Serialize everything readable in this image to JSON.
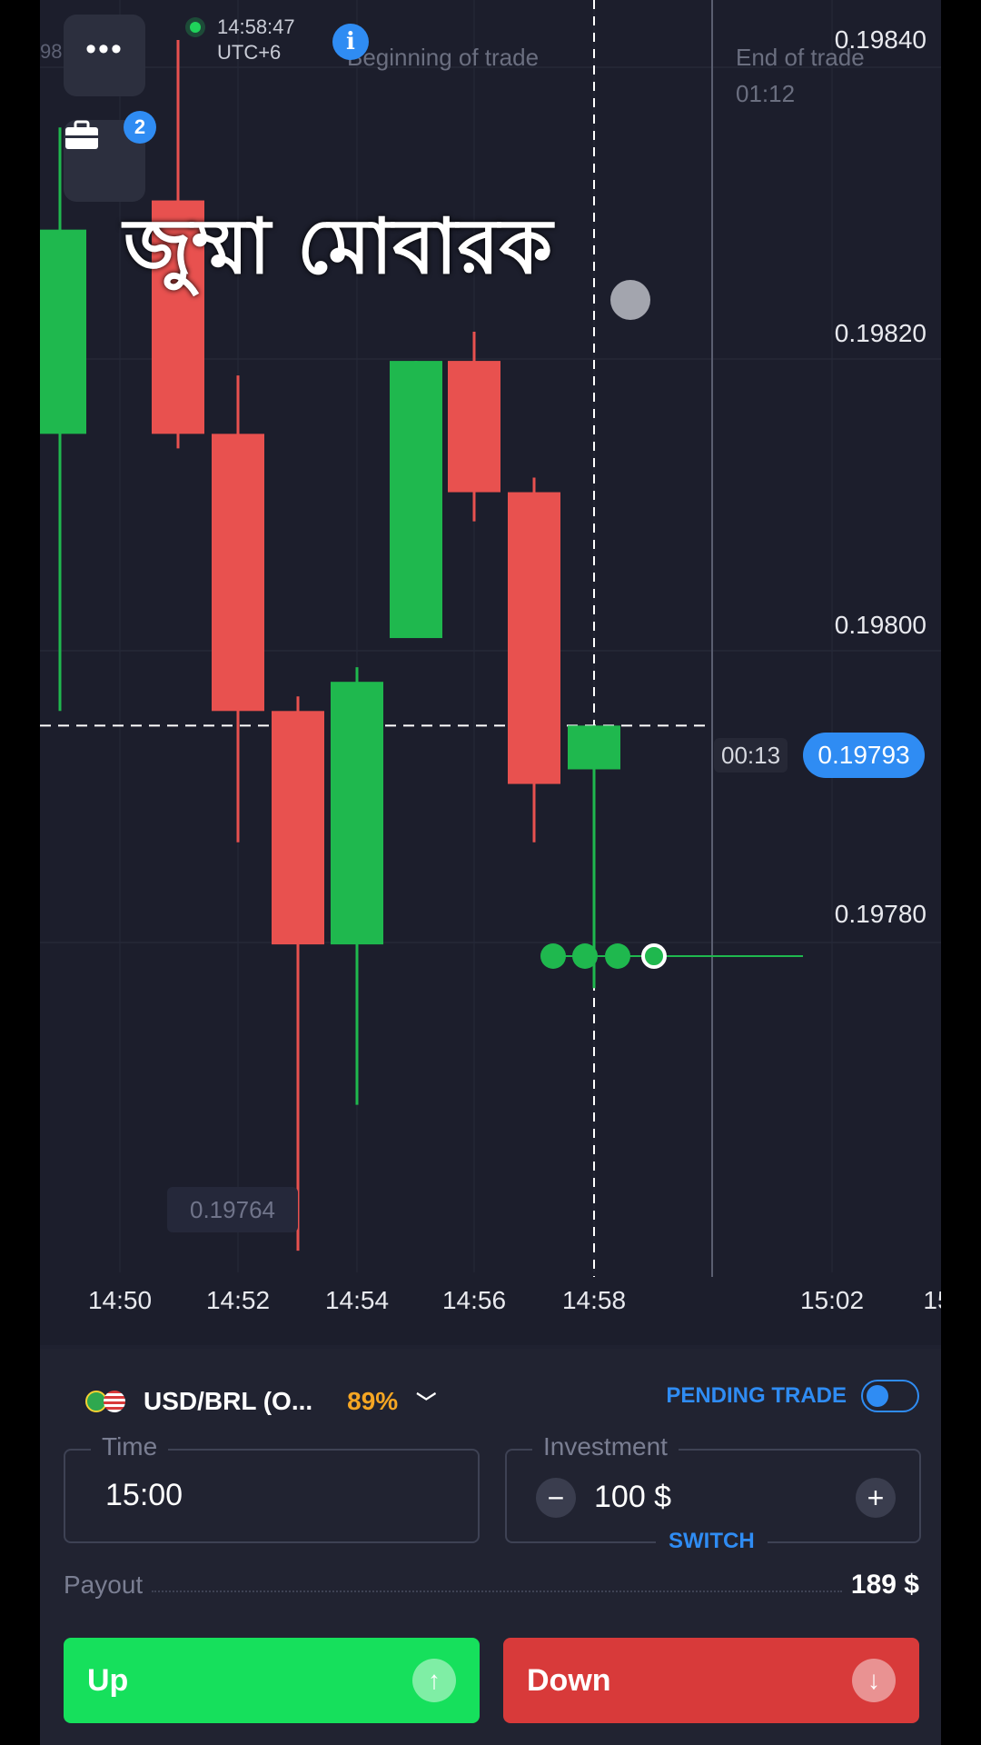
{
  "chart_data": {
    "type": "candlestick",
    "y_ticks": [
      "0.19840",
      "0.19820",
      "0.19800",
      "0.19780"
    ],
    "x_ticks": [
      "14:50",
      "14:52",
      "14:54",
      "14:56",
      "14:58",
      "15:02",
      "15"
    ],
    "candles": [
      {
        "open": 0.19813,
        "close": 0.19827,
        "high": 0.19834,
        "low": 0.19794,
        "color": "green"
      },
      {
        "open": 0.19829,
        "close": 0.19813,
        "high": 0.1984,
        "low": 0.19812,
        "color": "red"
      },
      {
        "open": 0.19813,
        "close": 0.19794,
        "high": 0.19817,
        "low": 0.19785,
        "color": "red"
      },
      {
        "open": 0.19794,
        "close": 0.19778,
        "high": 0.19795,
        "low": 0.19757,
        "color": "red"
      },
      {
        "open": 0.19778,
        "close": 0.19796,
        "high": 0.19797,
        "low": 0.19767,
        "color": "green"
      },
      {
        "open": 0.19799,
        "close": 0.19818,
        "high": 0.19818,
        "low": 0.19799,
        "color": "green"
      },
      {
        "open": 0.19818,
        "close": 0.19809,
        "high": 0.1982,
        "low": 0.19807,
        "color": "red"
      },
      {
        "open": 0.19809,
        "close": 0.19789,
        "high": 0.1981,
        "low": 0.19785,
        "color": "red"
      },
      {
        "open": 0.1979,
        "close": 0.19793,
        "high": 0.19793,
        "low": 0.19775,
        "color": "green"
      }
    ],
    "current_price": "0.19793",
    "low_marker": "0.19764"
  },
  "status": {
    "clock": "14:58:47",
    "timezone": "UTC+6"
  },
  "chart_labels": {
    "beginning": "Beginning of trade",
    "end": "End of trade",
    "end_time": "01:12",
    "countdown": "00:13",
    "overlay_text": "জুম্মা মোবারক",
    "badge_count": "2",
    "edge_price": "98"
  },
  "asset": {
    "name": "USD/BRL (O...",
    "payout_pct": "89%",
    "pending_trade": "PENDING TRADE"
  },
  "time_field": {
    "legend": "Time",
    "value": "15:00"
  },
  "investment_field": {
    "legend": "Investment",
    "value": "100 $",
    "switch": "SWITCH"
  },
  "payout": {
    "label": "Payout",
    "value": "189 $"
  },
  "buttons": {
    "up": "Up",
    "down": "Down"
  },
  "colors": {
    "up": "#16e05c",
    "down": "#d83a3a",
    "candle_green": "#1fb84e",
    "candle_red": "#e8514f",
    "accent": "#2f8cf3",
    "payout_orange": "#f5a623"
  }
}
